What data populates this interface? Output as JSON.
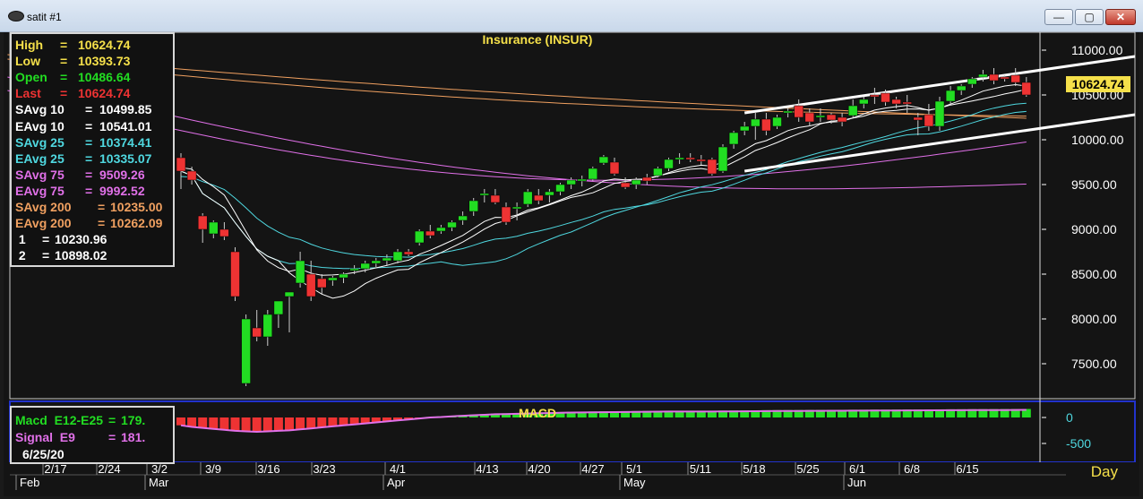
{
  "window": {
    "title": "satit #1",
    "minimize_label": "—",
    "restore_label": "▢",
    "close_label": "✕"
  },
  "colors": {
    "background": "#141414",
    "panel_border": "#c8c8c8",
    "up_candle": "#22dd22",
    "down_candle": "#ee3333",
    "title_yellow": "#f5e04a",
    "savg10": "#ffffff",
    "savg25": "#4fd8e0",
    "savg75": "#e070e8",
    "savg200": "#f0a060",
    "channel": "#ffffff",
    "macd_line": "#22dd22",
    "signal_line": "#e070e8",
    "last_price_bg": "#f5e04a"
  },
  "chart_data": [
    {
      "type": "candlestick",
      "title": "Insurance  (INSUR)",
      "ylim": [
        7100,
        11200
      ],
      "y_ticks": [
        "11000.00",
        "10500.00",
        "10000.00",
        "9500.00",
        "9000.00",
        "8500.00",
        "8000.00",
        "7500.00"
      ],
      "y_tick_values": [
        11000,
        10500,
        10000,
        9500,
        9000,
        8500,
        8000,
        7500
      ],
      "last_price_label": "10624.74",
      "last_price": 10624.74,
      "x_tick_labels": [
        "2/17",
        "2/24",
        "3/2",
        "3/9",
        "3/16",
        "3/23",
        "4/1",
        "4/13",
        "4/20",
        "4/27",
        "5/1",
        "5/11",
        "5/18",
        "5/25",
        "6/1",
        "6/8",
        "6/15"
      ],
      "month_labels": [
        "Feb",
        "Mar",
        "Apr",
        "May",
        "Jun"
      ],
      "period": "Day",
      "candles": [
        {
          "o": 9800,
          "h": 9850,
          "l": 9450,
          "c": 9650
        },
        {
          "o": 9650,
          "h": 9700,
          "l": 9500,
          "c": 9550
        },
        {
          "o": 9150,
          "h": 9180,
          "l": 8850,
          "c": 9000
        },
        {
          "o": 8950,
          "h": 9100,
          "l": 8900,
          "c": 9080
        },
        {
          "o": 9000,
          "h": 9080,
          "l": 8880,
          "c": 8920
        },
        {
          "o": 8750,
          "h": 8800,
          "l": 8200,
          "c": 8250
        },
        {
          "o": 7280,
          "h": 8050,
          "l": 7250,
          "c": 8000
        },
        {
          "o": 7900,
          "h": 8100,
          "l": 7750,
          "c": 7800
        },
        {
          "o": 7800,
          "h": 8100,
          "l": 7700,
          "c": 8050
        },
        {
          "o": 8050,
          "h": 8200,
          "l": 7900,
          "c": 8200
        },
        {
          "o": 8250,
          "h": 8300,
          "l": 7850,
          "c": 8300
        },
        {
          "o": 8400,
          "h": 8750,
          "l": 8350,
          "c": 8650
        },
        {
          "o": 8500,
          "h": 8650,
          "l": 8200,
          "c": 8250
        },
        {
          "o": 8450,
          "h": 8500,
          "l": 8280,
          "c": 8350
        },
        {
          "o": 8430,
          "h": 8480,
          "l": 8370,
          "c": 8460
        },
        {
          "o": 8460,
          "h": 8520,
          "l": 8400,
          "c": 8500
        },
        {
          "o": 8540,
          "h": 8600,
          "l": 8500,
          "c": 8560
        },
        {
          "o": 8560,
          "h": 8650,
          "l": 8520,
          "c": 8620
        },
        {
          "o": 8620,
          "h": 8680,
          "l": 8580,
          "c": 8650
        },
        {
          "o": 8650,
          "h": 8720,
          "l": 8600,
          "c": 8680
        },
        {
          "o": 8650,
          "h": 8780,
          "l": 8620,
          "c": 8750
        },
        {
          "o": 8750,
          "h": 8780,
          "l": 8700,
          "c": 8720
        },
        {
          "o": 8850,
          "h": 9000,
          "l": 8820,
          "c": 8980
        },
        {
          "o": 8980,
          "h": 9050,
          "l": 8900,
          "c": 8930
        },
        {
          "o": 8980,
          "h": 9050,
          "l": 8950,
          "c": 9020
        },
        {
          "o": 9020,
          "h": 9100,
          "l": 8980,
          "c": 9080
        },
        {
          "o": 9100,
          "h": 9200,
          "l": 9050,
          "c": 9150
        },
        {
          "o": 9200,
          "h": 9350,
          "l": 9150,
          "c": 9320
        },
        {
          "o": 9400,
          "h": 9450,
          "l": 9300,
          "c": 9400
        },
        {
          "o": 9380,
          "h": 9450,
          "l": 9280,
          "c": 9300
        },
        {
          "o": 9250,
          "h": 9300,
          "l": 9050,
          "c": 9080
        },
        {
          "o": 9250,
          "h": 9300,
          "l": 9100,
          "c": 9250
        },
        {
          "o": 9280,
          "h": 9450,
          "l": 9250,
          "c": 9420
        },
        {
          "o": 9380,
          "h": 9450,
          "l": 9280,
          "c": 9320
        },
        {
          "o": 9380,
          "h": 9450,
          "l": 9300,
          "c": 9420
        },
        {
          "o": 9420,
          "h": 9520,
          "l": 9380,
          "c": 9500
        },
        {
          "o": 9500,
          "h": 9580,
          "l": 9450,
          "c": 9550
        },
        {
          "o": 9560,
          "h": 9600,
          "l": 9480,
          "c": 9560
        },
        {
          "o": 9560,
          "h": 9700,
          "l": 9540,
          "c": 9680
        },
        {
          "o": 9740,
          "h": 9830,
          "l": 9720,
          "c": 9810
        },
        {
          "o": 9750,
          "h": 9800,
          "l": 9600,
          "c": 9620
        },
        {
          "o": 9520,
          "h": 9580,
          "l": 9450,
          "c": 9470
        },
        {
          "o": 9500,
          "h": 9580,
          "l": 9450,
          "c": 9550
        },
        {
          "o": 9580,
          "h": 9620,
          "l": 9500,
          "c": 9540
        },
        {
          "o": 9600,
          "h": 9700,
          "l": 9580,
          "c": 9680
        },
        {
          "o": 9680,
          "h": 9800,
          "l": 9650,
          "c": 9780
        },
        {
          "o": 9780,
          "h": 9850,
          "l": 9730,
          "c": 9800
        },
        {
          "o": 9800,
          "h": 9850,
          "l": 9750,
          "c": 9780
        },
        {
          "o": 9780,
          "h": 9830,
          "l": 9720,
          "c": 9760
        },
        {
          "o": 9780,
          "h": 9800,
          "l": 9600,
          "c": 9620
        },
        {
          "o": 9650,
          "h": 9950,
          "l": 9630,
          "c": 9920
        },
        {
          "o": 9950,
          "h": 10100,
          "l": 9900,
          "c": 10080
        },
        {
          "o": 10100,
          "h": 10200,
          "l": 10050,
          "c": 10150
        },
        {
          "o": 10150,
          "h": 10300,
          "l": 10000,
          "c": 10230
        },
        {
          "o": 10230,
          "h": 10300,
          "l": 10050,
          "c": 10100
        },
        {
          "o": 10150,
          "h": 10280,
          "l": 10120,
          "c": 10250
        },
        {
          "o": 10300,
          "h": 10360,
          "l": 10250,
          "c": 10320
        },
        {
          "o": 10380,
          "h": 10450,
          "l": 10200,
          "c": 10250
        },
        {
          "o": 10300,
          "h": 10350,
          "l": 10150,
          "c": 10200
        },
        {
          "o": 10250,
          "h": 10350,
          "l": 10200,
          "c": 10270
        },
        {
          "o": 10280,
          "h": 10300,
          "l": 10180,
          "c": 10220
        },
        {
          "o": 10250,
          "h": 10300,
          "l": 10150,
          "c": 10200
        },
        {
          "o": 10270,
          "h": 10450,
          "l": 10250,
          "c": 10380
        },
        {
          "o": 10400,
          "h": 10480,
          "l": 10350,
          "c": 10450
        },
        {
          "o": 10500,
          "h": 10580,
          "l": 10400,
          "c": 10480
        },
        {
          "o": 10520,
          "h": 10560,
          "l": 10380,
          "c": 10420
        },
        {
          "o": 10450,
          "h": 10480,
          "l": 10350,
          "c": 10400
        },
        {
          "o": 10420,
          "h": 10500,
          "l": 10300,
          "c": 10400
        },
        {
          "o": 10250,
          "h": 10300,
          "l": 10050,
          "c": 10220
        },
        {
          "o": 10280,
          "h": 10400,
          "l": 10100,
          "c": 10150
        },
        {
          "o": 10150,
          "h": 10480,
          "l": 10100,
          "c": 10430
        },
        {
          "o": 10430,
          "h": 10600,
          "l": 10400,
          "c": 10550
        },
        {
          "o": 10550,
          "h": 10620,
          "l": 10500,
          "c": 10600
        },
        {
          "o": 10620,
          "h": 10700,
          "l": 10580,
          "c": 10680
        },
        {
          "o": 10700,
          "h": 10780,
          "l": 10650,
          "c": 10730
        },
        {
          "o": 10730,
          "h": 10800,
          "l": 10620,
          "c": 10660
        },
        {
          "o": 10700,
          "h": 10720,
          "l": 10650,
          "c": 10690
        },
        {
          "o": 10720,
          "h": 10800,
          "l": 10600,
          "c": 10640
        },
        {
          "o": 10640,
          "h": 10700,
          "l": 10480,
          "c": 10500
        }
      ],
      "channel_lines": [
        {
          "x0": 52,
          "y0": 10300,
          "x1": 79,
          "y1": 10930
        },
        {
          "x0": 52,
          "y0": 9650,
          "x1": 79,
          "y1": 10280
        }
      ],
      "legend": [
        {
          "label": "High",
          "value": "10624.74",
          "color": "#f5e04a"
        },
        {
          "label": "Low",
          "value": "10393.73",
          "color": "#f5e04a"
        },
        {
          "label": "Open",
          "value": "10486.64",
          "color": "#22dd22"
        },
        {
          "label": "Last",
          "value": "10624.74",
          "color": "#ee3333"
        },
        {
          "label": "SAvg 10",
          "value": "10499.85",
          "color": "#ffffff"
        },
        {
          "label": "EAvg 10",
          "value": "10541.01",
          "color": "#ffffff"
        },
        {
          "label": "SAvg 25",
          "value": "10374.41",
          "color": "#4fd8e0"
        },
        {
          "label": "EAvg 25",
          "value": "10335.07",
          "color": "#4fd8e0"
        },
        {
          "label": "SAvg 75",
          "value": "9509.26",
          "color": "#e070e8"
        },
        {
          "label": "EAvg 75",
          "value": "9992.52",
          "color": "#e070e8"
        },
        {
          "label": "SAvg 200",
          "value": "10235.00",
          "color": "#f0a060"
        },
        {
          "label": "EAvg 200",
          "value": "10262.09",
          "color": "#f0a060"
        },
        {
          "label": " 1",
          "value": "10230.96",
          "color": "#ffffff"
        },
        {
          "label": " 2",
          "value": "10898.02",
          "color": "#ffffff"
        }
      ]
    },
    {
      "type": "bar",
      "title": "MACD",
      "y_ticks": [
        "0",
        "-500"
      ],
      "y_tick_values": [
        0,
        -500
      ],
      "ylim": [
        -700,
        300
      ],
      "macd_label": "Macd  E12-E25",
      "macd_value": "179.",
      "signal_label": "Signal  E9",
      "signal_value": "181.",
      "date": "6/25/20",
      "histogram": [
        -150,
        -180,
        -200,
        -220,
        -240,
        -260,
        -270,
        -280,
        -270,
        -260,
        -250,
        -230,
        -210,
        -190,
        -170,
        -150,
        -130,
        -110,
        -90,
        -70,
        -50,
        -30,
        -10,
        10,
        20,
        35,
        45,
        55,
        65,
        75,
        80,
        85,
        90,
        95,
        100,
        105,
        110,
        112,
        115,
        118,
        120,
        122,
        124,
        126,
        128,
        130,
        130,
        130,
        130,
        130,
        132,
        134,
        136,
        138,
        140,
        141,
        142,
        143,
        144,
        145,
        146,
        147,
        148,
        149,
        150,
        151,
        152,
        153,
        154,
        155,
        156,
        157,
        158,
        159,
        160,
        161,
        162,
        163,
        164
      ]
    }
  ]
}
